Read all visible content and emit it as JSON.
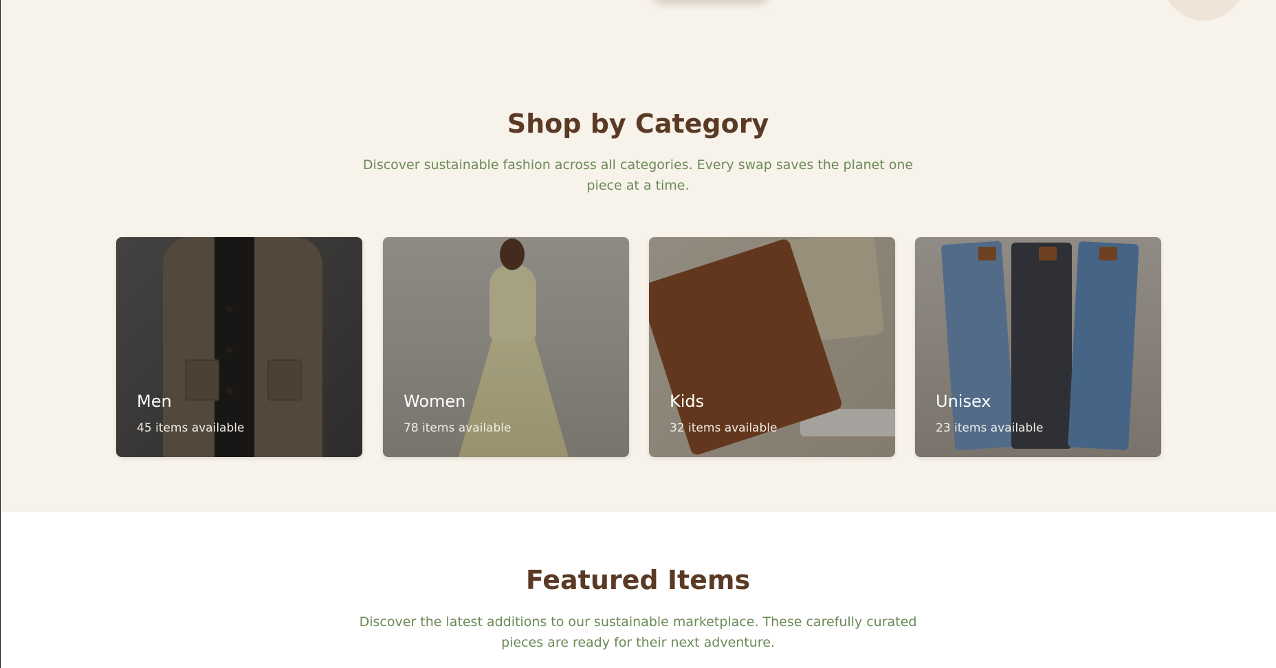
{
  "categories": {
    "title": "Shop by Category",
    "description": "Discover sustainable fashion across all categories. Every swap saves the planet one piece at a time.",
    "items": [
      {
        "name": "Men",
        "count": "45 items available",
        "image": "men-jacket-photo"
      },
      {
        "name": "Women",
        "count": "78 items available",
        "image": "women-dress-photo"
      },
      {
        "name": "Kids",
        "count": "32 items available",
        "image": "kids-clothes-photo"
      },
      {
        "name": "Unisex",
        "count": "23 items available",
        "image": "unisex-jeans-photo"
      }
    ]
  },
  "featured": {
    "title": "Featured Items",
    "description": "Discover the latest additions to our sustainable marketplace. These carefully curated pieces are ready for their next adventure."
  },
  "colors": {
    "section_bg": "#f7f2ea",
    "title": "#5a3a24",
    "description": "#6a8a55"
  }
}
